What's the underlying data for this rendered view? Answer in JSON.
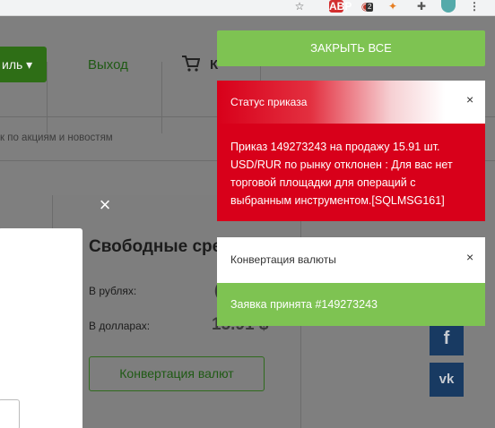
{
  "browser": {
    "star_icon": "☆",
    "abp_label": "ABP",
    "extension_badge": "2"
  },
  "header": {
    "profile_label": "иль ▾",
    "logout_label": "Выход",
    "cart_label": "К",
    "search_placeholder": "к по акциям и новостям"
  },
  "balance": {
    "title": "Свободные сред",
    "rub_label": "В рублях:",
    "rub_value": "(",
    "usd_label": "В долларах:",
    "usd_value": "15.91 $",
    "convert_button": "Конвертация валют"
  },
  "social": {
    "facebook": "f",
    "vk": "vk"
  },
  "notifications": {
    "close_all": "ЗАКРЫТЬ ВСЕ",
    "error": {
      "title": "Статус приказа",
      "close": "×",
      "body": "Приказ 149273243 на продажу 15.91 шт. USD/RUR по рынку отклонен : Для вас нет торговой площадки для операций с выбранным инструментом.[SQLMSG161]"
    },
    "success": {
      "title": "Конвертация валюты",
      "close": "×",
      "body": "Заявка принята #149273243"
    }
  },
  "modal": {
    "close": "×"
  },
  "colors": {
    "error_red": "#d8001a",
    "success_green": "#7ec352",
    "brand_green": "#2e6e16",
    "social_navy": "#183a62"
  }
}
